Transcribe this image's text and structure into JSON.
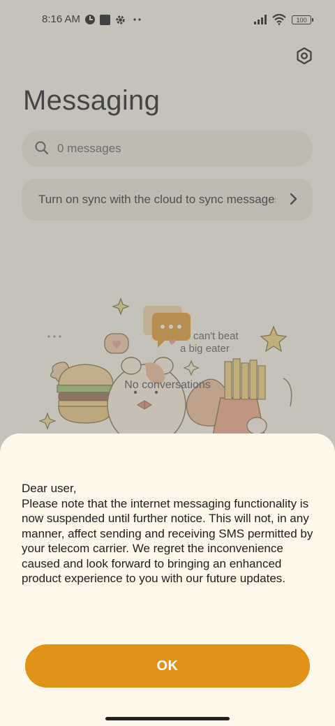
{
  "status_bar": {
    "time": "8:16 AM",
    "battery": "100",
    "icons": [
      "vpn-icon",
      "stop-square-icon",
      "gear-icon",
      "more-dots-icon",
      "signal-icon",
      "wifi-icon",
      "battery-icon"
    ]
  },
  "header": {
    "title": "Messaging",
    "settings_icon": "hexagon-settings-icon"
  },
  "search": {
    "placeholder": "0 messages"
  },
  "sync_banner": {
    "label": "Turn on sync with the cloud to sync messages"
  },
  "empty_state": {
    "label": "No conversations",
    "illustration_text": [
      "can't beat",
      "a big eater"
    ]
  },
  "dialog": {
    "message": "Dear user,\nPlease note that the internet messaging functionality is now suspended until further notice. This will not, in any manner, affect sending and receiving SMS permitted by your telecom carrier. We regret the inconvenience caused and look forward to bringing an enhanced product experience to you with our future updates.",
    "ok_label": "OK"
  },
  "colors": {
    "accent": "#e09316",
    "background": "#fdf8e9",
    "scrim": "rgba(118,118,118,0.42)"
  }
}
